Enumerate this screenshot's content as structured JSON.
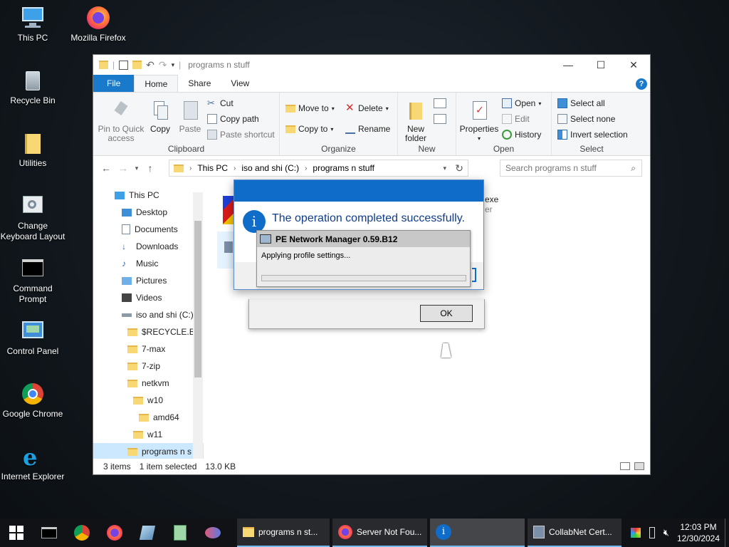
{
  "desktop": {
    "icons": [
      {
        "label": "This PC"
      },
      {
        "label": "Mozilla Firefox"
      },
      {
        "label": "Recycle Bin"
      },
      {
        "label": "Utilities"
      },
      {
        "label": "Change Keyboard Layout"
      },
      {
        "label": "Command Prompt"
      },
      {
        "label": "Control Panel"
      },
      {
        "label": "Google Chrome"
      },
      {
        "label": "Internet Explorer"
      }
    ]
  },
  "explorer": {
    "title": "programs n stuff",
    "tabs": {
      "file": "File",
      "home": "Home",
      "share": "Share",
      "view": "View"
    },
    "ribbon": {
      "clipboard": {
        "pin": "Pin to Quick access",
        "copy": "Copy",
        "paste": "Paste",
        "cut": "Cut",
        "copy_path": "Copy path",
        "paste_shortcut": "Paste shortcut",
        "group": "Clipboard"
      },
      "organize": {
        "move_to": "Move to",
        "copy_to": "Copy to",
        "delete": "Delete",
        "rename": "Rename",
        "group": "Organize"
      },
      "new": {
        "new_folder": "New folder",
        "group": "New"
      },
      "open": {
        "properties": "Properties",
        "open": "Open",
        "edit": "Edit",
        "history": "History",
        "group": "Open"
      },
      "select": {
        "select_all": "Select all",
        "select_none": "Select none",
        "invert": "Invert selection",
        "group": "Select"
      }
    },
    "address": {
      "parts": [
        "This PC",
        "iso and shi (C:)",
        "programs n stuff"
      ]
    },
    "search_placeholder": "Search programs n stuff",
    "nav": [
      {
        "label": "This PC"
      },
      {
        "label": "Desktop"
      },
      {
        "label": "Documents"
      },
      {
        "label": "Downloads"
      },
      {
        "label": "Music"
      },
      {
        "label": "Pictures"
      },
      {
        "label": "Videos"
      },
      {
        "label": "iso and shi (C:)"
      },
      {
        "label": "$RECYCLE.BIN"
      },
      {
        "label": "7-max"
      },
      {
        "label": "7-zip"
      },
      {
        "label": "netkvm"
      },
      {
        "label": "w10"
      },
      {
        "label": "amd64"
      },
      {
        "label": "w11"
      },
      {
        "label": "programs n s"
      }
    ],
    "file_partial": {
      "ext": "exe",
      "sub": "er"
    },
    "status": {
      "items": "3 items",
      "selected": "1 item selected",
      "size": "13.0 KB"
    }
  },
  "message_box": {
    "text": "The operation completed successfully.",
    "ok": "OK"
  },
  "pe_dialog": {
    "title": "PE Network Manager 0.59.B12",
    "status": "Applying profile settings...",
    "progress": 0
  },
  "taskbar": {
    "windows": [
      {
        "label": "programs n st..."
      },
      {
        "label": "Server Not Fou..."
      },
      {
        "label": ""
      },
      {
        "label": "CollabNet Cert..."
      }
    ],
    "time": "12:03 PM",
    "date": "12/30/2024"
  },
  "colors": {
    "accent": "#1979ca",
    "titlebar_blue": "#0f6cc8",
    "folder": "#f8d775"
  }
}
